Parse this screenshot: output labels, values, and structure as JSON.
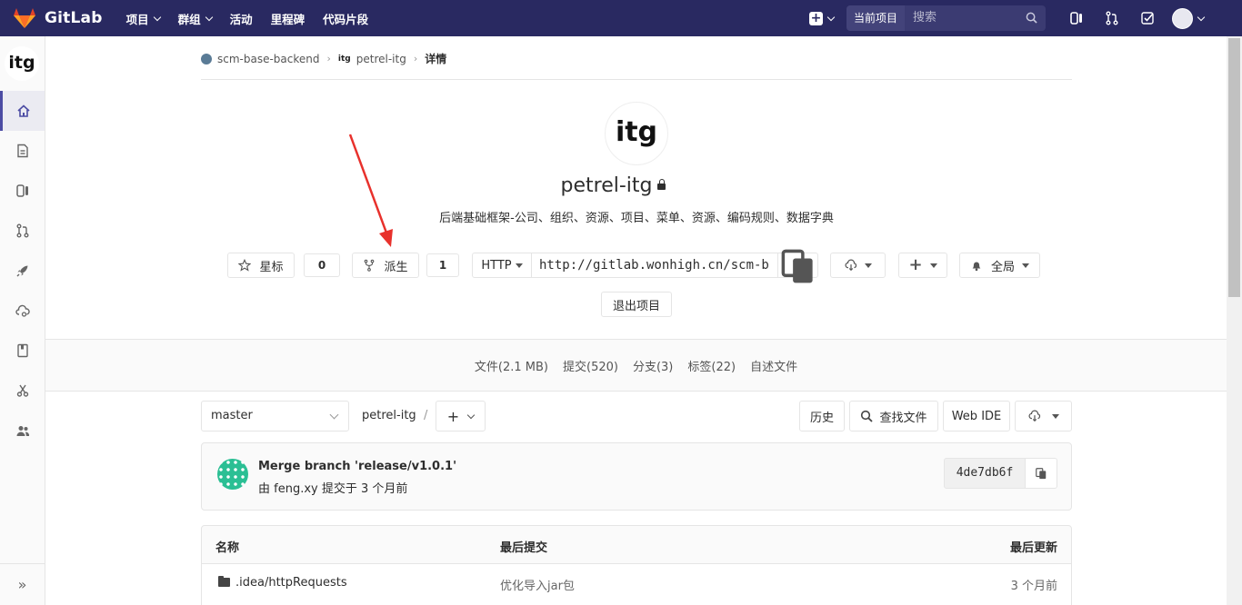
{
  "navbar": {
    "brand": "GitLab",
    "links": [
      {
        "label": "项目",
        "dropdown": true
      },
      {
        "label": "群组",
        "dropdown": true
      },
      {
        "label": "活动",
        "dropdown": false
      },
      {
        "label": "里程碑",
        "dropdown": false
      },
      {
        "label": "代码片段",
        "dropdown": false
      }
    ],
    "search_scope": "当前项目",
    "search_placeholder": "搜索",
    "icons": [
      "plus-icon",
      "issues-icon",
      "merge-request-icon",
      "todo-icon",
      "avatar"
    ],
    "background_color": "#292961"
  },
  "sidebar": {
    "project_avatar_text": "itg",
    "items": [
      "home-icon",
      "repository-icon",
      "issues-icon",
      "merge-request-icon",
      "ci-cd-icon",
      "operations-icon",
      "wiki-icon",
      "snippets-icon",
      "members-icon"
    ],
    "active_index": 0,
    "collapse_glyph": "»"
  },
  "breadcrumb": {
    "group": "scm-base-backend",
    "project_avatar_text": "itg",
    "project": "petrel-itg",
    "current": "详情",
    "separator": "›"
  },
  "project": {
    "logo_text": "itg",
    "name": "petrel-itg",
    "visibility": "private",
    "description": "后端基础框架-公司、组织、资源、项目、菜单、资源、编码规则、数据字典",
    "star_label": "星标",
    "star_count": "0",
    "fork_label": "派生",
    "fork_count": "1",
    "clone_protocol": "HTTP",
    "clone_url": "http://gitlab.wonhigh.cn/scm-b",
    "notification_label": "全局",
    "leave_label": "退出项目"
  },
  "stats": [
    "文件(2.1 MB)",
    "提交(520)",
    "分支(3)",
    "标签(22)",
    "自述文件"
  ],
  "file_nav": {
    "branch": "master",
    "path": "petrel-itg",
    "path_sep": "/",
    "add_glyph": "+",
    "history_label": "历史",
    "find_file_label": "查找文件",
    "web_ide_label": "Web IDE"
  },
  "commit": {
    "title": "Merge branch 'release/v1.0.1'",
    "meta": "由 feng.xy 提交于 3 个月前",
    "sha": "4de7db6f",
    "avatar_color": "#2bbf94"
  },
  "table": {
    "headers": [
      "名称",
      "最后提交",
      "最后更新"
    ],
    "rows": [
      {
        "name": ".idea/httpRequests",
        "last_commit": "优化导入jar包",
        "updated": "3 个月前"
      }
    ]
  },
  "annotation_arrow_color": "#e8312c"
}
